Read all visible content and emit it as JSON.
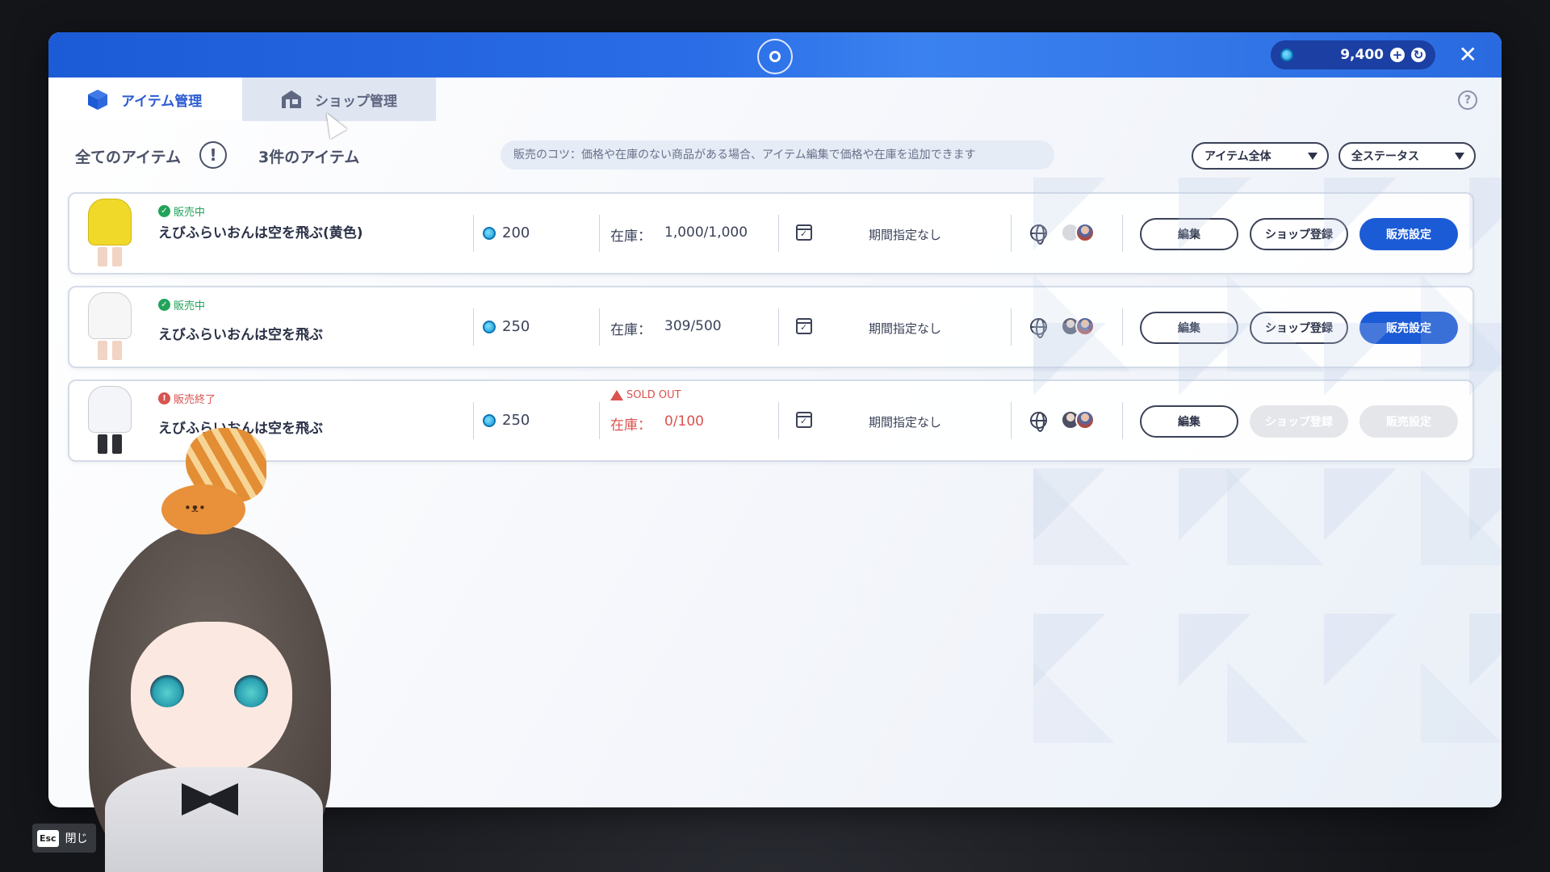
{
  "header": {
    "currency_amount": "9,400",
    "plus_label": "+",
    "close_label": "✕"
  },
  "tabs": [
    {
      "label": "アイテム管理",
      "active": true
    },
    {
      "label": "ショップ管理",
      "active": false
    }
  ],
  "help_label": "?",
  "filters": {
    "all_items_label": "全てのアイテム",
    "warning_label": "!",
    "count_label": "3件のアイテム",
    "tip": "販売のコツ：価格や在庫のない商品がある場合、アイテム編集で価格や在庫を追加できます",
    "category_select": "アイテム全体",
    "status_select": "全ステータス"
  },
  "items": [
    {
      "status": "販売中",
      "name": "えびふらいおんは空を飛ぶ(黄色)",
      "price": "200",
      "stock_label": "在庫：",
      "stock": "1,000/1,000",
      "period": "期間指定なし",
      "edit": "編集",
      "shop_register": "ショップ登録",
      "sale_settings": "販売設定"
    },
    {
      "status": "販売中",
      "name": "えびふらいおんは空を飛ぶ",
      "price": "250",
      "stock_label": "在庫：",
      "stock": "309/500",
      "period": "期間指定なし",
      "edit": "編集",
      "shop_register": "ショップ登録",
      "sale_settings": "販売設定"
    },
    {
      "status": "販売終了",
      "name": "えびふらいおんは空を飛ぶ",
      "price": "250",
      "soldout": "SOLD OUT",
      "stock_label": "在庫：",
      "stock": "0/100",
      "period": "期間指定なし",
      "edit": "編集",
      "shop_register": "ショップ登録",
      "sale_settings": "販売設定"
    }
  ],
  "esc": {
    "key": "Esc",
    "label": "閉じ"
  },
  "colors": {
    "accent": "#1c5bd6",
    "on_sale": "#22a35a",
    "ended": "#d9534f"
  }
}
